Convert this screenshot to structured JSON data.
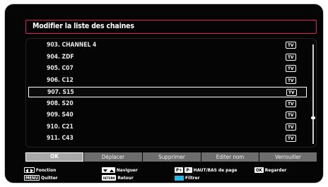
{
  "title": "Modifier la liste des chaines",
  "channels": [
    {
      "name": "903. CHANNEL 4",
      "type": "TV"
    },
    {
      "name": "904. ZDF",
      "type": "TV"
    },
    {
      "name": "905. C07",
      "type": "TV"
    },
    {
      "name": "906. C12",
      "type": "TV"
    },
    {
      "name": "907. S15",
      "type": "TV"
    },
    {
      "name": "908. S20",
      "type": "TV"
    },
    {
      "name": "909. S40",
      "type": "TV"
    },
    {
      "name": "910. C21",
      "type": "TV"
    },
    {
      "name": "911. C43",
      "type": "TV"
    }
  ],
  "selected_index": 4,
  "buttons": [
    "OK",
    "Déplacer",
    "Supprimer",
    "Editer nom",
    "Verrouiller"
  ],
  "legend": {
    "function": "Fonction",
    "navigate": "Naviguer",
    "page": "HAUT/BAS de page",
    "watch": "Regarder",
    "quit": "Quitter",
    "back": "Retour",
    "filter": "Filtrer",
    "key_menu": "MENU",
    "key_ok": "OK",
    "key_pplus": "P+",
    "key_pminus": "P-",
    "key_return": "RETURN"
  },
  "colors": {
    "accent": "#e0205a",
    "filter_key": "#26b8e0"
  }
}
